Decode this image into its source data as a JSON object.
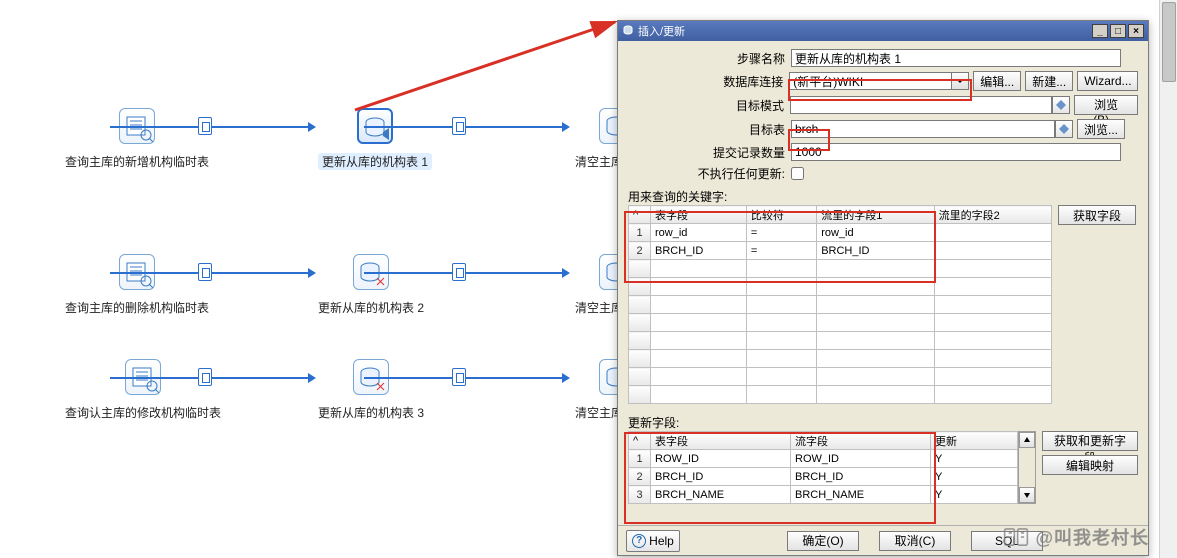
{
  "nodes": {
    "r1c1": "查询主库的新增机构临时表",
    "r1c2": "更新从库的机构表 1",
    "r1c3": "清空主库的新增",
    "r2c1": "查询主库的删除机构临时表",
    "r2c2": "更新从库的机构表 2",
    "r2c3": "清空主库的删除",
    "r3c1": "查询认主库的修改机构临时表",
    "r3c2": "更新从库的机构表 3",
    "r3c3": "清空主库的修改"
  },
  "dialog": {
    "title": "插入/更新",
    "labels": {
      "step_name": "步骤名称",
      "connection": "数据库连接",
      "target_schema": "目标模式",
      "target_table": "目标表",
      "commit_size": "提交记录数量",
      "no_update": "不执行任何更新:",
      "key_section": "用来查询的关键字:",
      "update_section": "更新字段:"
    },
    "values": {
      "step_name": "更新从库的机构表 1",
      "connection": "(新平台)WIKI",
      "target_schema": "",
      "target_table": "brch",
      "commit_size": "1000"
    },
    "buttons": {
      "edit": "编辑...",
      "new": "新建...",
      "wizard": "Wizard...",
      "browse1": "浏览(B)...",
      "browse2": "浏览...",
      "get_fields": "获取字段",
      "get_update_fields": "获取和更新字段",
      "edit_mapping": "编辑映射",
      "help": "Help",
      "ok": "确定(O)",
      "cancel": "取消(C)",
      "sql": "SQL"
    },
    "key_cols": {
      "c1": "表字段",
      "c2": "比较符",
      "c3": "流里的字段1",
      "c4": "流里的字段2"
    },
    "key_rows": [
      {
        "n": "1",
        "f": "row_id",
        "op": "=",
        "s1": "row_id",
        "s2": ""
      },
      {
        "n": "2",
        "f": "BRCH_ID",
        "op": "=",
        "s1": "BRCH_ID",
        "s2": ""
      }
    ],
    "upd_cols": {
      "c1": "表字段",
      "c2": "流字段",
      "c3": "更新"
    },
    "upd_rows": [
      {
        "n": "1",
        "f": "ROW_ID",
        "s": "ROW_ID",
        "u": "Y"
      },
      {
        "n": "2",
        "f": "BRCH_ID",
        "s": "BRCH_ID",
        "u": "Y"
      },
      {
        "n": "3",
        "f": "BRCH_NAME",
        "s": "BRCH_NAME",
        "u": "Y"
      }
    ]
  },
  "watermark": "@叫我老村长"
}
